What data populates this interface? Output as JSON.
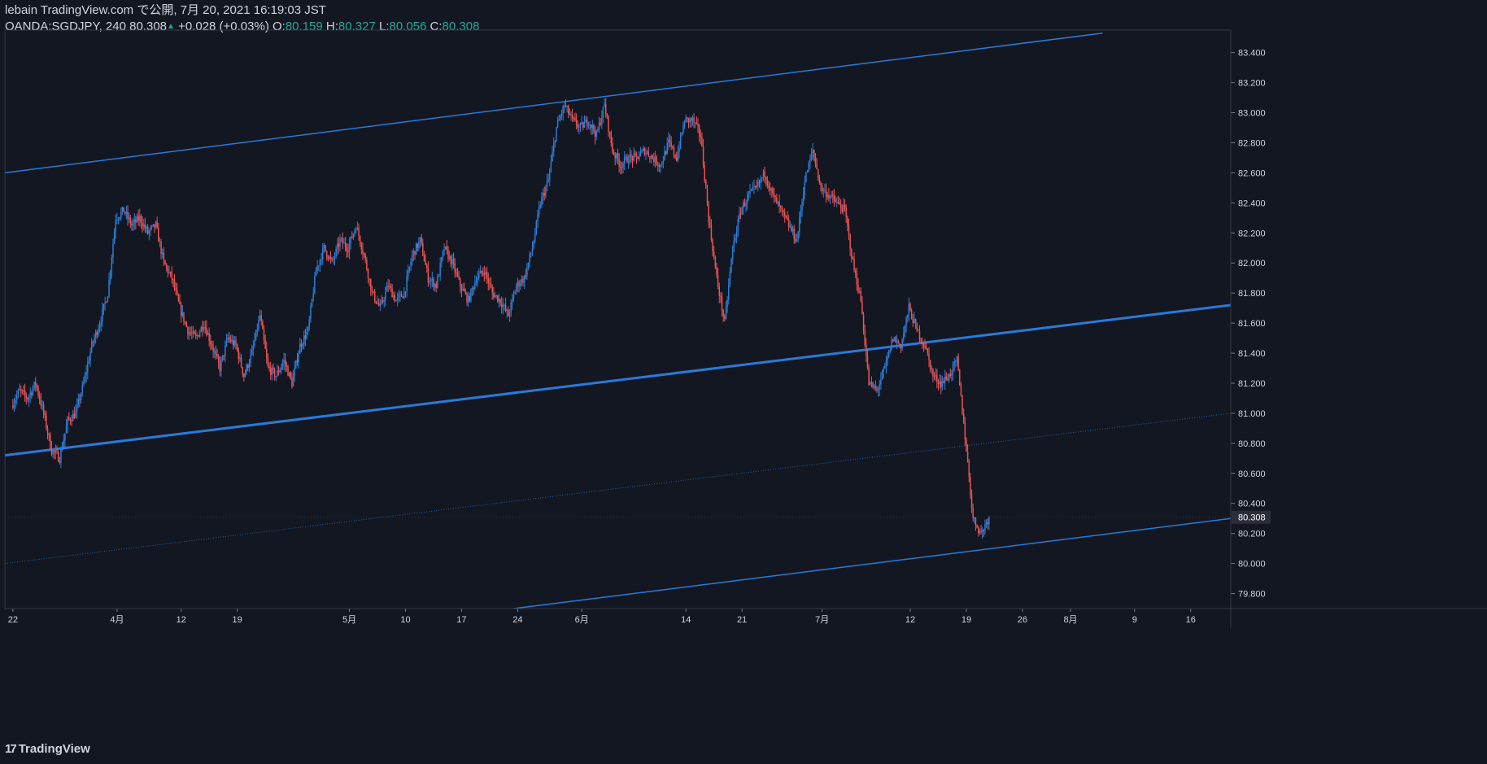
{
  "header": {
    "line1": "lebain TradingView.com で公開, 7月 20, 2021 16:19:03 JST",
    "symbol": "OANDA:SGDJPY, 240 80.308",
    "change": "+0.028 (+0.03%)",
    "o_label": "O:",
    "o_val": "80.159",
    "h_label": "H:",
    "h_val": "80.327",
    "l_label": "L:",
    "l_val": "80.056",
    "c_label": "C:",
    "c_val": "80.308"
  },
  "footer": {
    "brand": "TradingView"
  },
  "colors": {
    "background": "#131722",
    "up": "#2962ff",
    "up_candle": "#2d7fd8",
    "down_candle": "#ef5350",
    "channel": "#2a7ad9",
    "price_label_bg": "#2a2e39"
  },
  "chart_data": {
    "type": "candlestick",
    "symbol": "OANDA:SGDJPY",
    "interval": "240",
    "y_range": [
      79.7,
      83.55
    ],
    "y_ticks": [
      "83.400",
      "83.200",
      "83.000",
      "82.800",
      "82.600",
      "82.400",
      "82.200",
      "82.000",
      "81.800",
      "81.600",
      "81.400",
      "81.200",
      "81.000",
      "80.800",
      "80.600",
      "80.400",
      "80.200",
      "80.000",
      "79.800"
    ],
    "current_price": "80.308",
    "x_ticks": [
      "22",
      "4月",
      "12",
      "19",
      "5月",
      "10",
      "17",
      "24",
      "6月",
      "14",
      "21",
      "7月",
      "12",
      "19",
      "26",
      "8月",
      "9",
      "16"
    ],
    "x_tick_days": [
      0,
      13,
      21,
      28,
      42,
      49,
      56,
      63,
      71,
      84,
      91,
      101,
      112,
      119,
      126,
      132,
      140,
      147
    ],
    "x_range_days": [
      -1,
      152
    ],
    "price_path": [
      [
        0,
        81.05
      ],
      [
        1,
        81.15
      ],
      [
        2,
        81.1
      ],
      [
        3,
        81.2
      ],
      [
        4,
        81.0
      ],
      [
        5,
        80.75
      ],
      [
        6,
        80.7
      ],
      [
        7,
        80.95
      ],
      [
        8,
        81.0
      ],
      [
        9,
        81.2
      ],
      [
        10,
        81.45
      ],
      [
        11,
        81.6
      ],
      [
        12,
        81.8
      ],
      [
        13,
        82.3
      ],
      [
        14,
        82.35
      ],
      [
        15,
        82.25
      ],
      [
        16,
        82.3
      ],
      [
        17,
        82.2
      ],
      [
        18,
        82.25
      ],
      [
        19,
        82.0
      ],
      [
        20,
        81.9
      ],
      [
        21,
        81.7
      ],
      [
        22,
        81.55
      ],
      [
        23,
        81.5
      ],
      [
        24,
        81.6
      ],
      [
        25,
        81.45
      ],
      [
        26,
        81.3
      ],
      [
        27,
        81.5
      ],
      [
        28,
        81.45
      ],
      [
        29,
        81.25
      ],
      [
        30,
        81.4
      ],
      [
        31,
        81.65
      ],
      [
        32,
        81.3
      ],
      [
        33,
        81.25
      ],
      [
        34,
        81.35
      ],
      [
        35,
        81.2
      ],
      [
        36,
        81.45
      ],
      [
        37,
        81.55
      ],
      [
        38,
        81.95
      ],
      [
        39,
        82.1
      ],
      [
        40,
        82.0
      ],
      [
        41,
        82.15
      ],
      [
        42,
        82.1
      ],
      [
        43,
        82.25
      ],
      [
        44,
        82.05
      ],
      [
        45,
        81.8
      ],
      [
        46,
        81.7
      ],
      [
        47,
        81.85
      ],
      [
        48,
        81.75
      ],
      [
        49,
        81.8
      ],
      [
        50,
        82.05
      ],
      [
        51,
        82.15
      ],
      [
        52,
        81.9
      ],
      [
        53,
        81.85
      ],
      [
        54,
        82.1
      ],
      [
        55,
        82.0
      ],
      [
        56,
        81.85
      ],
      [
        57,
        81.75
      ],
      [
        58,
        81.9
      ],
      [
        59,
        81.95
      ],
      [
        60,
        81.8
      ],
      [
        61,
        81.75
      ],
      [
        62,
        81.65
      ],
      [
        63,
        81.85
      ],
      [
        64,
        81.9
      ],
      [
        65,
        82.1
      ],
      [
        66,
        82.4
      ],
      [
        67,
        82.55
      ],
      [
        68,
        82.9
      ],
      [
        69,
        83.05
      ],
      [
        70,
        82.95
      ],
      [
        71,
        82.9
      ],
      [
        72,
        82.95
      ],
      [
        73,
        82.85
      ],
      [
        74,
        83.05
      ],
      [
        75,
        82.75
      ],
      [
        76,
        82.65
      ],
      [
        77,
        82.7
      ],
      [
        78,
        82.7
      ],
      [
        79,
        82.75
      ],
      [
        80,
        82.7
      ],
      [
        81,
        82.65
      ],
      [
        82,
        82.8
      ],
      [
        83,
        82.7
      ],
      [
        84,
        82.95
      ],
      [
        85,
        82.95
      ],
      [
        86,
        82.85
      ],
      [
        87,
        82.3
      ],
      [
        88,
        81.9
      ],
      [
        89,
        81.6
      ],
      [
        90,
        82.1
      ],
      [
        91,
        82.35
      ],
      [
        92,
        82.45
      ],
      [
        93,
        82.5
      ],
      [
        94,
        82.6
      ],
      [
        95,
        82.45
      ],
      [
        96,
        82.35
      ],
      [
        97,
        82.25
      ],
      [
        98,
        82.15
      ],
      [
        99,
        82.55
      ],
      [
        100,
        82.75
      ],
      [
        101,
        82.5
      ],
      [
        102,
        82.45
      ],
      [
        103,
        82.4
      ],
      [
        104,
        82.35
      ],
      [
        105,
        82.0
      ],
      [
        106,
        81.75
      ],
      [
        107,
        81.2
      ],
      [
        108,
        81.15
      ],
      [
        109,
        81.3
      ],
      [
        110,
        81.5
      ],
      [
        111,
        81.45
      ],
      [
        112,
        81.7
      ],
      [
        113,
        81.55
      ],
      [
        114,
        81.45
      ],
      [
        115,
        81.25
      ],
      [
        116,
        81.2
      ],
      [
        117,
        81.25
      ],
      [
        118,
        81.35
      ],
      [
        119,
        80.85
      ],
      [
        120,
        80.3
      ],
      [
        121,
        80.2
      ],
      [
        122,
        80.31
      ]
    ],
    "channel_lines": [
      {
        "role": "upper",
        "from": [
          -1,
          82.6
        ],
        "to": [
          136,
          83.53
        ],
        "width": 1.5
      },
      {
        "role": "middle",
        "from": [
          -1,
          80.72
        ],
        "to": [
          152,
          81.72
        ],
        "width": 3
      },
      {
        "role": "dotted",
        "from": [
          -1,
          80.0
        ],
        "to": [
          152,
          81.0
        ],
        "width": 1,
        "dotted": true
      },
      {
        "role": "lower",
        "from": [
          62.5,
          79.7
        ],
        "to": [
          152,
          80.3
        ],
        "width": 1.5
      }
    ]
  }
}
